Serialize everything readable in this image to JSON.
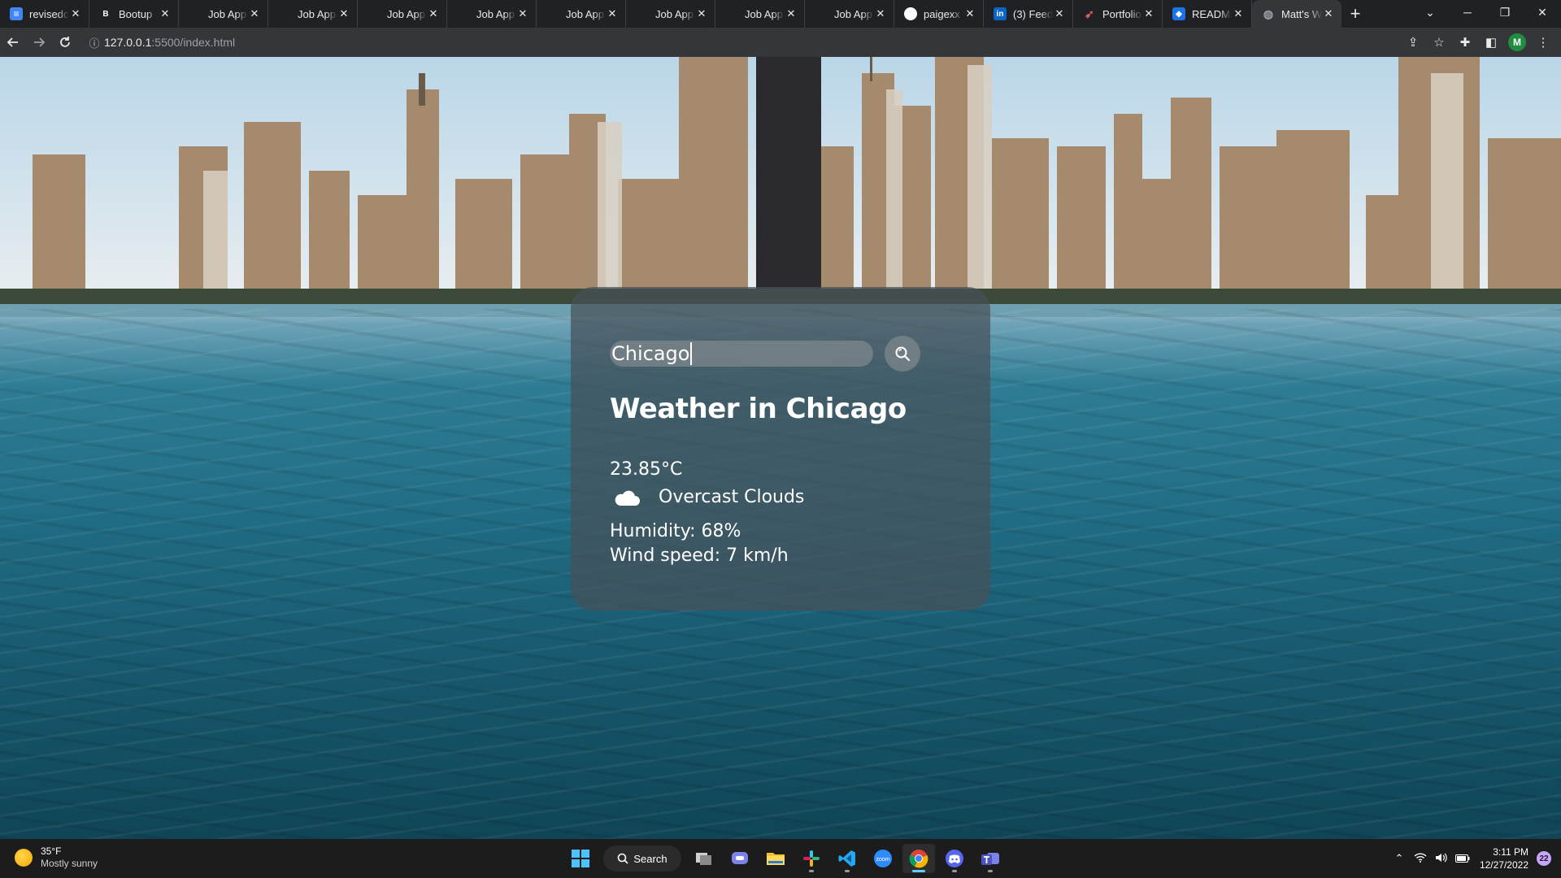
{
  "browser": {
    "tabs": [
      {
        "title": "revisedc",
        "icon": "docs-icon",
        "color": "#4285f4",
        "glyph": "≡"
      },
      {
        "title": "Bootup",
        "icon": "bootcamp-icon",
        "color": "#202124",
        "glyph": "B"
      },
      {
        "title": "Job App",
        "icon": "blank-page-icon",
        "color": "",
        "glyph": ""
      },
      {
        "title": "Job App",
        "icon": "blank-page-icon",
        "color": "",
        "glyph": ""
      },
      {
        "title": "Job App",
        "icon": "blank-page-icon",
        "color": "",
        "glyph": ""
      },
      {
        "title": "Job App",
        "icon": "blank-page-icon",
        "color": "",
        "glyph": ""
      },
      {
        "title": "Job App",
        "icon": "blank-page-icon",
        "color": "",
        "glyph": ""
      },
      {
        "title": "Job App",
        "icon": "blank-page-icon",
        "color": "",
        "glyph": ""
      },
      {
        "title": "Job App",
        "icon": "blank-page-icon",
        "color": "",
        "glyph": ""
      },
      {
        "title": "Job App",
        "icon": "blank-page-icon",
        "color": "",
        "glyph": ""
      },
      {
        "title": "paigexx",
        "icon": "github-icon",
        "color": "#ffffff",
        "glyph": "●"
      },
      {
        "title": "(3) Feed",
        "icon": "linkedin-icon",
        "color": "#0a66c2",
        "glyph": "in"
      },
      {
        "title": "Portfolio",
        "icon": "portfolio-icon",
        "color": "#8a1c1c",
        "glyph": "➹"
      },
      {
        "title": "README",
        "icon": "readme-icon",
        "color": "#1a73e8",
        "glyph": "◆"
      },
      {
        "title": "Matt's W",
        "icon": "globe-icon",
        "color": "#9aa0a6",
        "glyph": "◍",
        "active": true
      }
    ],
    "new_tab_label": "+",
    "address": {
      "host": "127.0.0.1",
      "path": ":5500/index.html"
    },
    "profile_initial": "M"
  },
  "weather_app": {
    "search": {
      "value": "Chicago"
    },
    "title": "Weather in Chicago",
    "temperature": "23.85°C",
    "description": "Overcast Clouds",
    "description_icon": "cloud-icon",
    "humidity": "Humidity: 68%",
    "wind_speed": "Wind speed: 7 km/h"
  },
  "taskbar": {
    "weather_temp": "35°F",
    "weather_desc": "Mostly sunny",
    "search_label": "Search",
    "time": "3:11 PM",
    "date": "12/27/2022",
    "notification_count": "22",
    "apps": [
      "start-icon",
      "task-view-icon",
      "teams-chat-icon",
      "file-explorer-icon",
      "slack-icon",
      "vscode-icon",
      "zoom-icon",
      "chrome-icon",
      "discord-icon",
      "teams-icon"
    ],
    "zoom_label": "zoom"
  }
}
